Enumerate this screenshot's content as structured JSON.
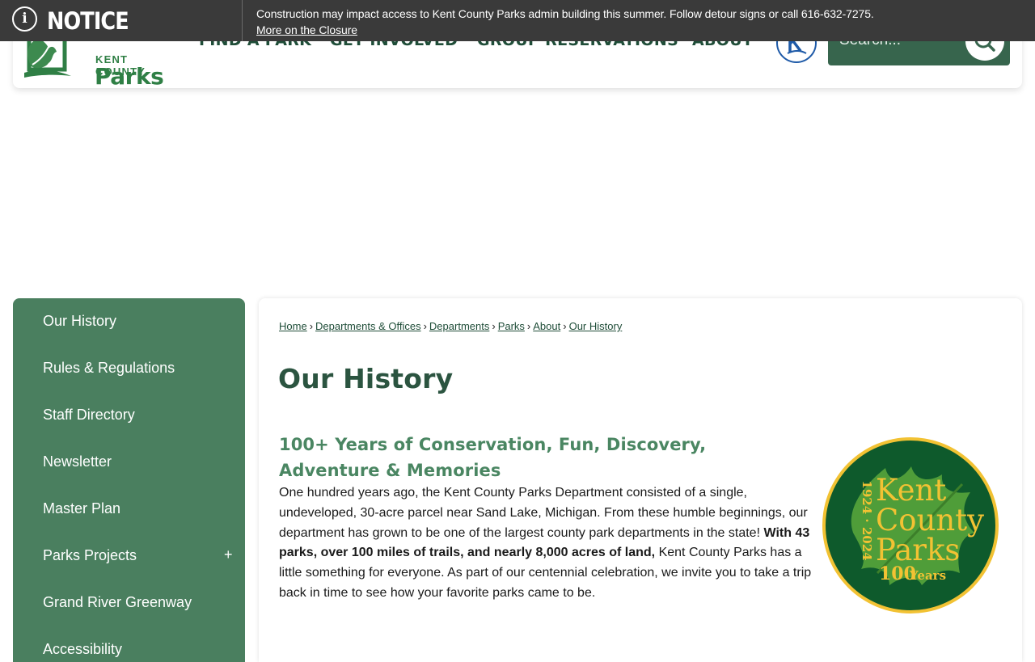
{
  "notice": {
    "title": "NOTICE",
    "message": "Construction may impact access to Kent County Parks admin building this summer. Follow detour signs or call 616-632-7275.",
    "link_label": "More on the Closure"
  },
  "header": {
    "logo": {
      "line1": "KENT COUNTY",
      "line2": "Parks"
    },
    "nav": [
      "FIND A PARK",
      "GET INVOLVED",
      "GROUP RESERVATIONS",
      "ABOUT"
    ],
    "search_placeholder": "Search..."
  },
  "sidebar": {
    "items": [
      {
        "label": "Our History"
      },
      {
        "label": "Rules & Regulations"
      },
      {
        "label": "Staff Directory"
      },
      {
        "label": "Newsletter"
      },
      {
        "label": "Master Plan"
      },
      {
        "label": "Parks Projects",
        "expand": "+"
      },
      {
        "label": "Grand River Greenway"
      },
      {
        "label": "Accessibility"
      }
    ]
  },
  "breadcrumb": [
    "Home",
    "Departments & Offices",
    "Departments",
    "Parks",
    "About",
    "Our History"
  ],
  "page": {
    "title": "Our History",
    "subheading": "100+ Years of Conservation, Fun, Discovery, Adventure & Memories",
    "body_part1": "One hundred years ago, the Kent County Parks Department consisted of a single, undeveloped, 30-acre parcel near Sand Lake, Michigan. From these humble beginnings, our department has grown to be one of the largest county park departments in the state!",
    "body_bold": "With 43 parks, over 100 miles of trails, and nearly 8,000 acres of land,",
    "body_part2": "Kent County Parks has a little something for everyone. As part of our centennial celebration, we invite you to take a trip back in time to see how your favorite parks came to be."
  },
  "badge": {
    "line1": "Kent",
    "line2": "County",
    "line3": "Parks",
    "years_range": "1924 · 2024",
    "anniversary": "Years"
  },
  "colors": {
    "notice_bg": "#3a3a3a",
    "brand_green": "#2f7f45",
    "sidebar_green": "#4a7f5f",
    "heading_dark": "#2b5440",
    "subheading_green": "#4a8662",
    "badge_gold": "#f2c233"
  }
}
